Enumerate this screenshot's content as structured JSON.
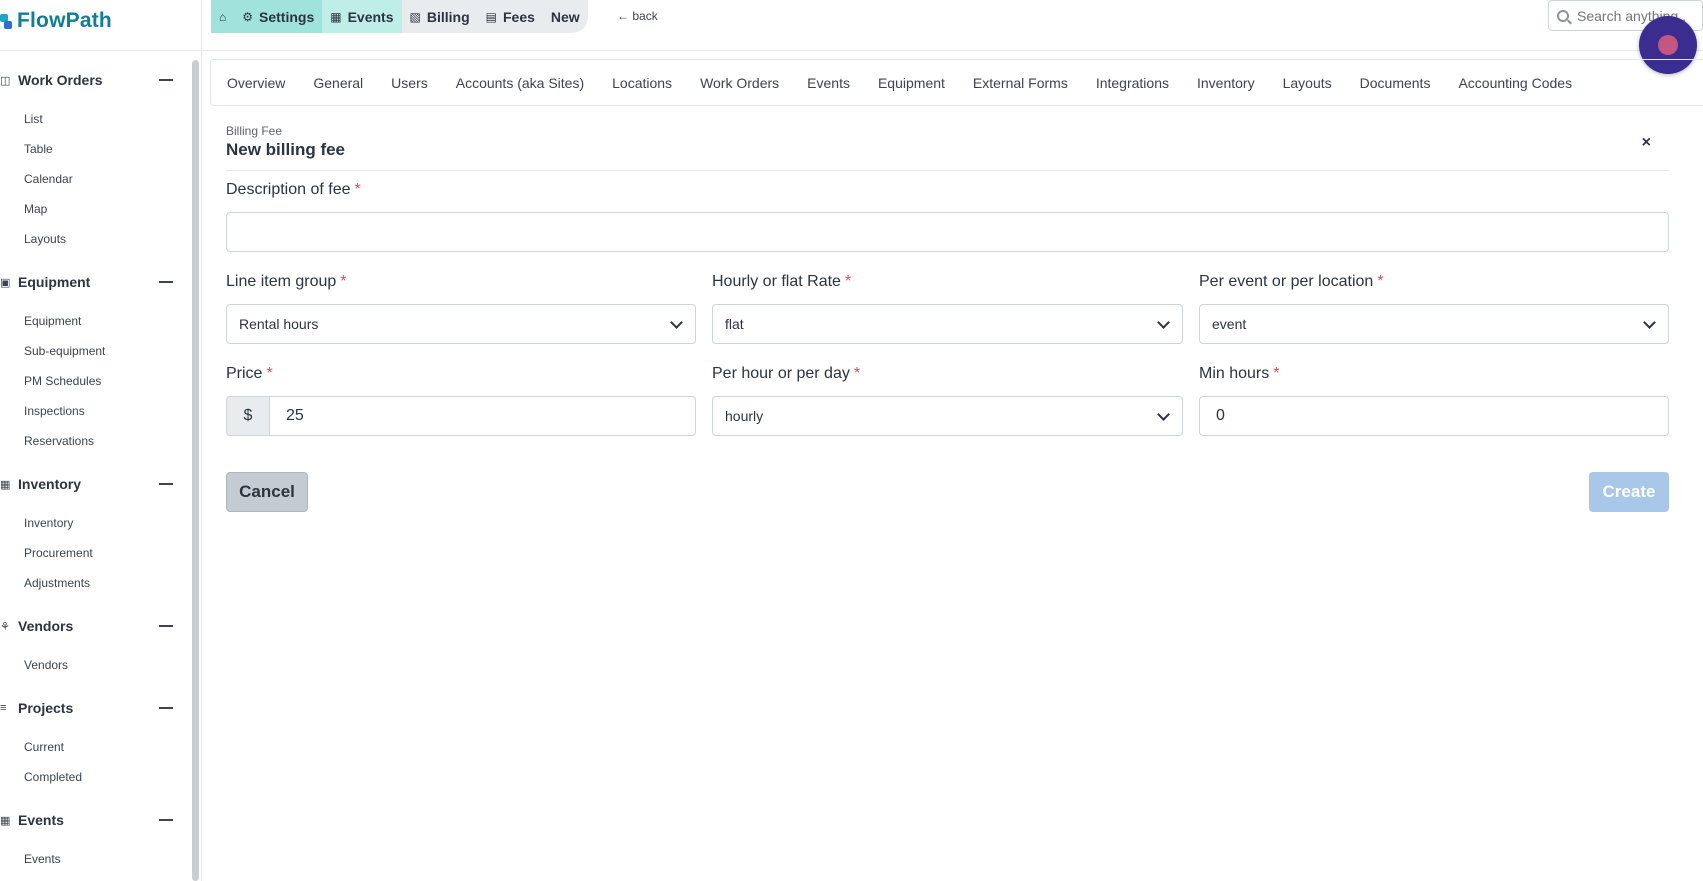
{
  "app": {
    "logo_text": "FlowPath"
  },
  "sidebar": {
    "sections": [
      {
        "title": "Work Orders",
        "icon": "clipboard-icon",
        "items": [
          "List",
          "Table",
          "Calendar",
          "Map",
          "Layouts"
        ]
      },
      {
        "title": "Equipment",
        "icon": "truck-icon",
        "items": [
          "Equipment",
          "Sub-equipment",
          "PM Schedules",
          "Inspections",
          "Reservations"
        ]
      },
      {
        "title": "Inventory",
        "icon": "boxes-icon",
        "items": [
          "Inventory",
          "Procurement",
          "Adjustments"
        ]
      },
      {
        "title": "Vendors",
        "icon": "handshake-icon",
        "items": [
          "Vendors"
        ]
      },
      {
        "title": "Projects",
        "icon": "tasks-icon",
        "items": [
          "Current",
          "Completed"
        ]
      },
      {
        "title": "Events",
        "icon": "calendar-icon",
        "items": [
          "Events"
        ]
      }
    ]
  },
  "breadcrumb": {
    "items": [
      {
        "label": "",
        "icon": "home-icon"
      },
      {
        "label": "Settings",
        "icon": "gears-icon"
      },
      {
        "label": "Events",
        "icon": "calendar-icon"
      },
      {
        "label": "Billing",
        "icon": "invoice-icon"
      },
      {
        "label": "Fees",
        "icon": "money-icon"
      },
      {
        "label": "New",
        "icon": ""
      }
    ],
    "back_label": "back"
  },
  "search": {
    "placeholder": "Search anything..."
  },
  "tabs": [
    "Overview",
    "General",
    "Users",
    "Accounts (aka Sites)",
    "Locations",
    "Work Orders",
    "Events",
    "Equipment",
    "External Forms",
    "Integrations",
    "Inventory",
    "Layouts",
    "Documents",
    "Accounting Codes"
  ],
  "form": {
    "subtitle": "Billing Fee",
    "title": "New billing fee",
    "close_label": "×",
    "required_mark": "*",
    "description": {
      "label": "Description of fee",
      "value": ""
    },
    "line_item_group": {
      "label": "Line item group",
      "value": "Rental hours"
    },
    "rate_type": {
      "label": "Hourly or flat Rate",
      "value": "flat"
    },
    "per_event_location": {
      "label": "Per event or per location",
      "value": "event"
    },
    "price": {
      "label": "Price",
      "prefix": "$",
      "value": "25"
    },
    "per_hour_day": {
      "label": "Per hour or per day",
      "value": "hourly"
    },
    "min_hours": {
      "label": "Min hours",
      "value": "0"
    },
    "cancel_label": "Cancel",
    "create_label": "Create"
  },
  "colors": {
    "accent": "#0d7f9a",
    "crumb_active": "#9fe3dc",
    "create_disabled": "#a9c7e8",
    "required": "#d9534f",
    "avatar": "#3a2d8f"
  }
}
